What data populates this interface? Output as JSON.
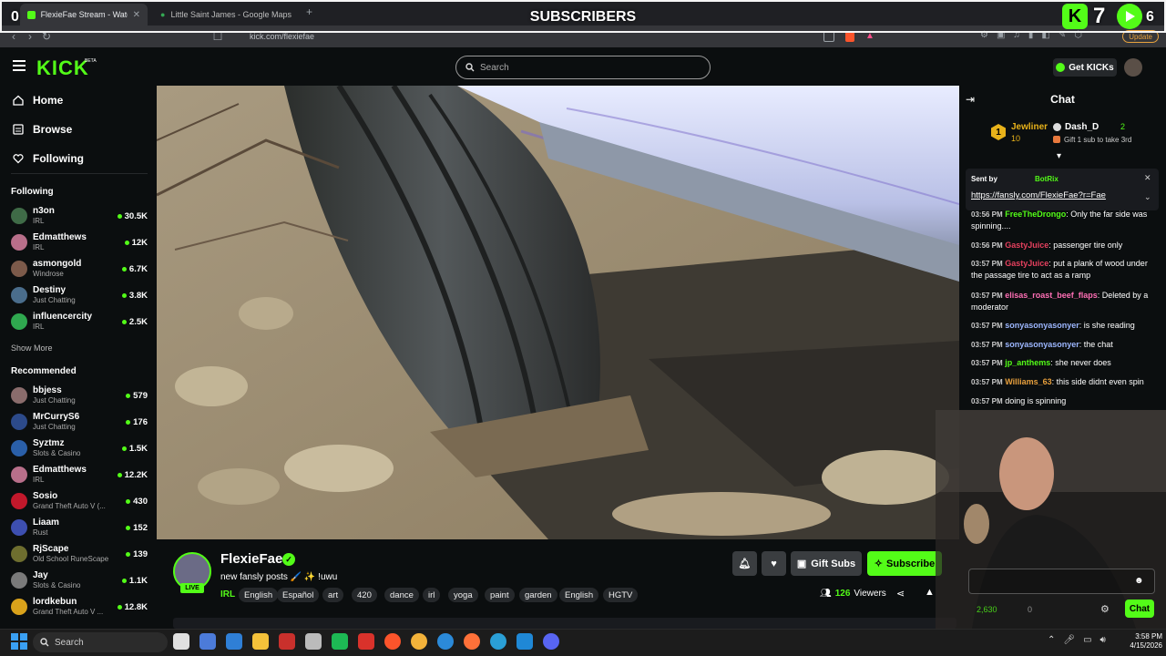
{
  "browser": {
    "tabs": [
      {
        "title": "FlexieFae Stream - Watch Live"
      },
      {
        "title": "Little Saint James - Google Maps"
      }
    ],
    "url": "kick.com/flexiefae",
    "update_label": "Update"
  },
  "overlay": {
    "left_value": "0",
    "banner": "SUBSCRIBERS",
    "count1": "7",
    "count2": "6"
  },
  "header": {
    "logo": "KICK",
    "beta": "BETA",
    "search_placeholder": "Search",
    "get_kicks": "Get KICKs"
  },
  "sidebar": {
    "nav": [
      {
        "label": "Home",
        "icon": "home-icon"
      },
      {
        "label": "Browse",
        "icon": "browse-icon"
      },
      {
        "label": "Following",
        "icon": "heart-icon"
      }
    ],
    "following_title": "Following",
    "following": [
      {
        "name": "n3on",
        "category": "IRL",
        "viewers": "30.5K",
        "color": "#3f6b47"
      },
      {
        "name": "Edmatthews",
        "category": "IRL",
        "viewers": "12K",
        "color": "#b86f8a"
      },
      {
        "name": "asmongold",
        "category": "Windrose",
        "viewers": "6.7K",
        "color": "#7c5a4a"
      },
      {
        "name": "Destiny",
        "category": "Just Chatting",
        "viewers": "3.8K",
        "color": "#4a6d8c"
      },
      {
        "name": "influencercity",
        "category": "IRL",
        "viewers": "2.5K",
        "color": "#2fa84f"
      }
    ],
    "show_more": "Show More",
    "recommended_title": "Recommended",
    "recommended": [
      {
        "name": "bbjess",
        "category": "Just Chatting",
        "viewers": "579",
        "color": "#8a6c6c"
      },
      {
        "name": "MrCurryS6",
        "category": "Just Chatting",
        "viewers": "176",
        "color": "#2c4a8a"
      },
      {
        "name": "Syztmz",
        "category": "Slots & Casino",
        "viewers": "1.5K",
        "color": "#2a5fa8"
      },
      {
        "name": "Edmatthews",
        "category": "IRL",
        "viewers": "12.2K",
        "color": "#b86f8a"
      },
      {
        "name": "Sosio",
        "category": "Grand Theft Auto V (...",
        "viewers": "430",
        "color": "#c2182b"
      },
      {
        "name": "Liaam",
        "category": "Rust",
        "viewers": "152",
        "color": "#3d4fb0"
      },
      {
        "name": "RjScape",
        "category": "Old School RuneScape",
        "viewers": "139",
        "color": "#6e6e2f"
      },
      {
        "name": "Jay",
        "category": "Slots & Casino",
        "viewers": "1.1K",
        "color": "#7a7a7a"
      },
      {
        "name": "lordkebun",
        "category": "Grand Theft Auto V ...",
        "viewers": "12.8K",
        "color": "#d9a21b"
      }
    ]
  },
  "stream": {
    "name": "FlexieFae",
    "title": "new fansly posts 🖌️ ✨ !uwu",
    "category": "IRL",
    "live": "LIVE",
    "tags": [
      "English",
      "Español",
      "art",
      "420",
      "dance",
      "irl",
      "yoga",
      "paint",
      "garden",
      "English",
      "HGTV"
    ],
    "viewers_count": "126",
    "viewers_label": "Viewers",
    "gift_subs": "Gift Subs",
    "subscribe": "Subscribe"
  },
  "chat": {
    "title": "Chat",
    "leaderboard": {
      "rank": "1",
      "first_name": "Jewliner",
      "first_count": "10",
      "second_name": "Dash_D",
      "second_count": "2",
      "gift_note": "Gift 1 sub to take 3rd"
    },
    "pinned": {
      "sent_by": "Sent by",
      "bot": "BotRix",
      "link": "https://fansly.com/FlexieFae?r=Fae"
    },
    "messages": [
      {
        "time": "03:56 PM",
        "user": "FreeTheDrongo",
        "text": ": Only the far side was spinning....",
        "color": "#53fc18"
      },
      {
        "time": "03:56 PM",
        "user": "GastyJuice",
        "text": ": passenger tire only",
        "color": "#e5405e"
      },
      {
        "time": "03:57 PM",
        "user": "GastyJuice",
        "text": ": put a plank of wood under the passage tire to act as a ramp",
        "color": "#e5405e"
      },
      {
        "time": "03:57 PM",
        "user": "elisas_roast_beef_flaps",
        "text": ": Deleted by a moderator",
        "color": "#ff6fb5"
      },
      {
        "time": "03:57 PM",
        "user": "sonyasonyasonyer",
        "text": ": is she reading",
        "color": "#9db7ff"
      },
      {
        "time": "03:57 PM",
        "user": "sonyasonyasonyer",
        "text": ": the chat",
        "color": "#9db7ff"
      },
      {
        "time": "03:57 PM",
        "user": "jp_anthems",
        "text": ": she never does",
        "color": "#53fc18"
      },
      {
        "time": "03:57 PM",
        "user": "Williams_63",
        "text": ": this side didnt even spin",
        "color": "#e8a03d"
      },
      {
        "time": "03:57 PM",
        "user": "",
        "text": "doing is spinning",
        "color": "#ffffff"
      }
    ],
    "kicks_count": "2,630",
    "zero": "0",
    "send_label": "Chat"
  },
  "taskbar": {
    "search": "Search",
    "time": "3:58 PM",
    "date": "4/15/2026"
  }
}
